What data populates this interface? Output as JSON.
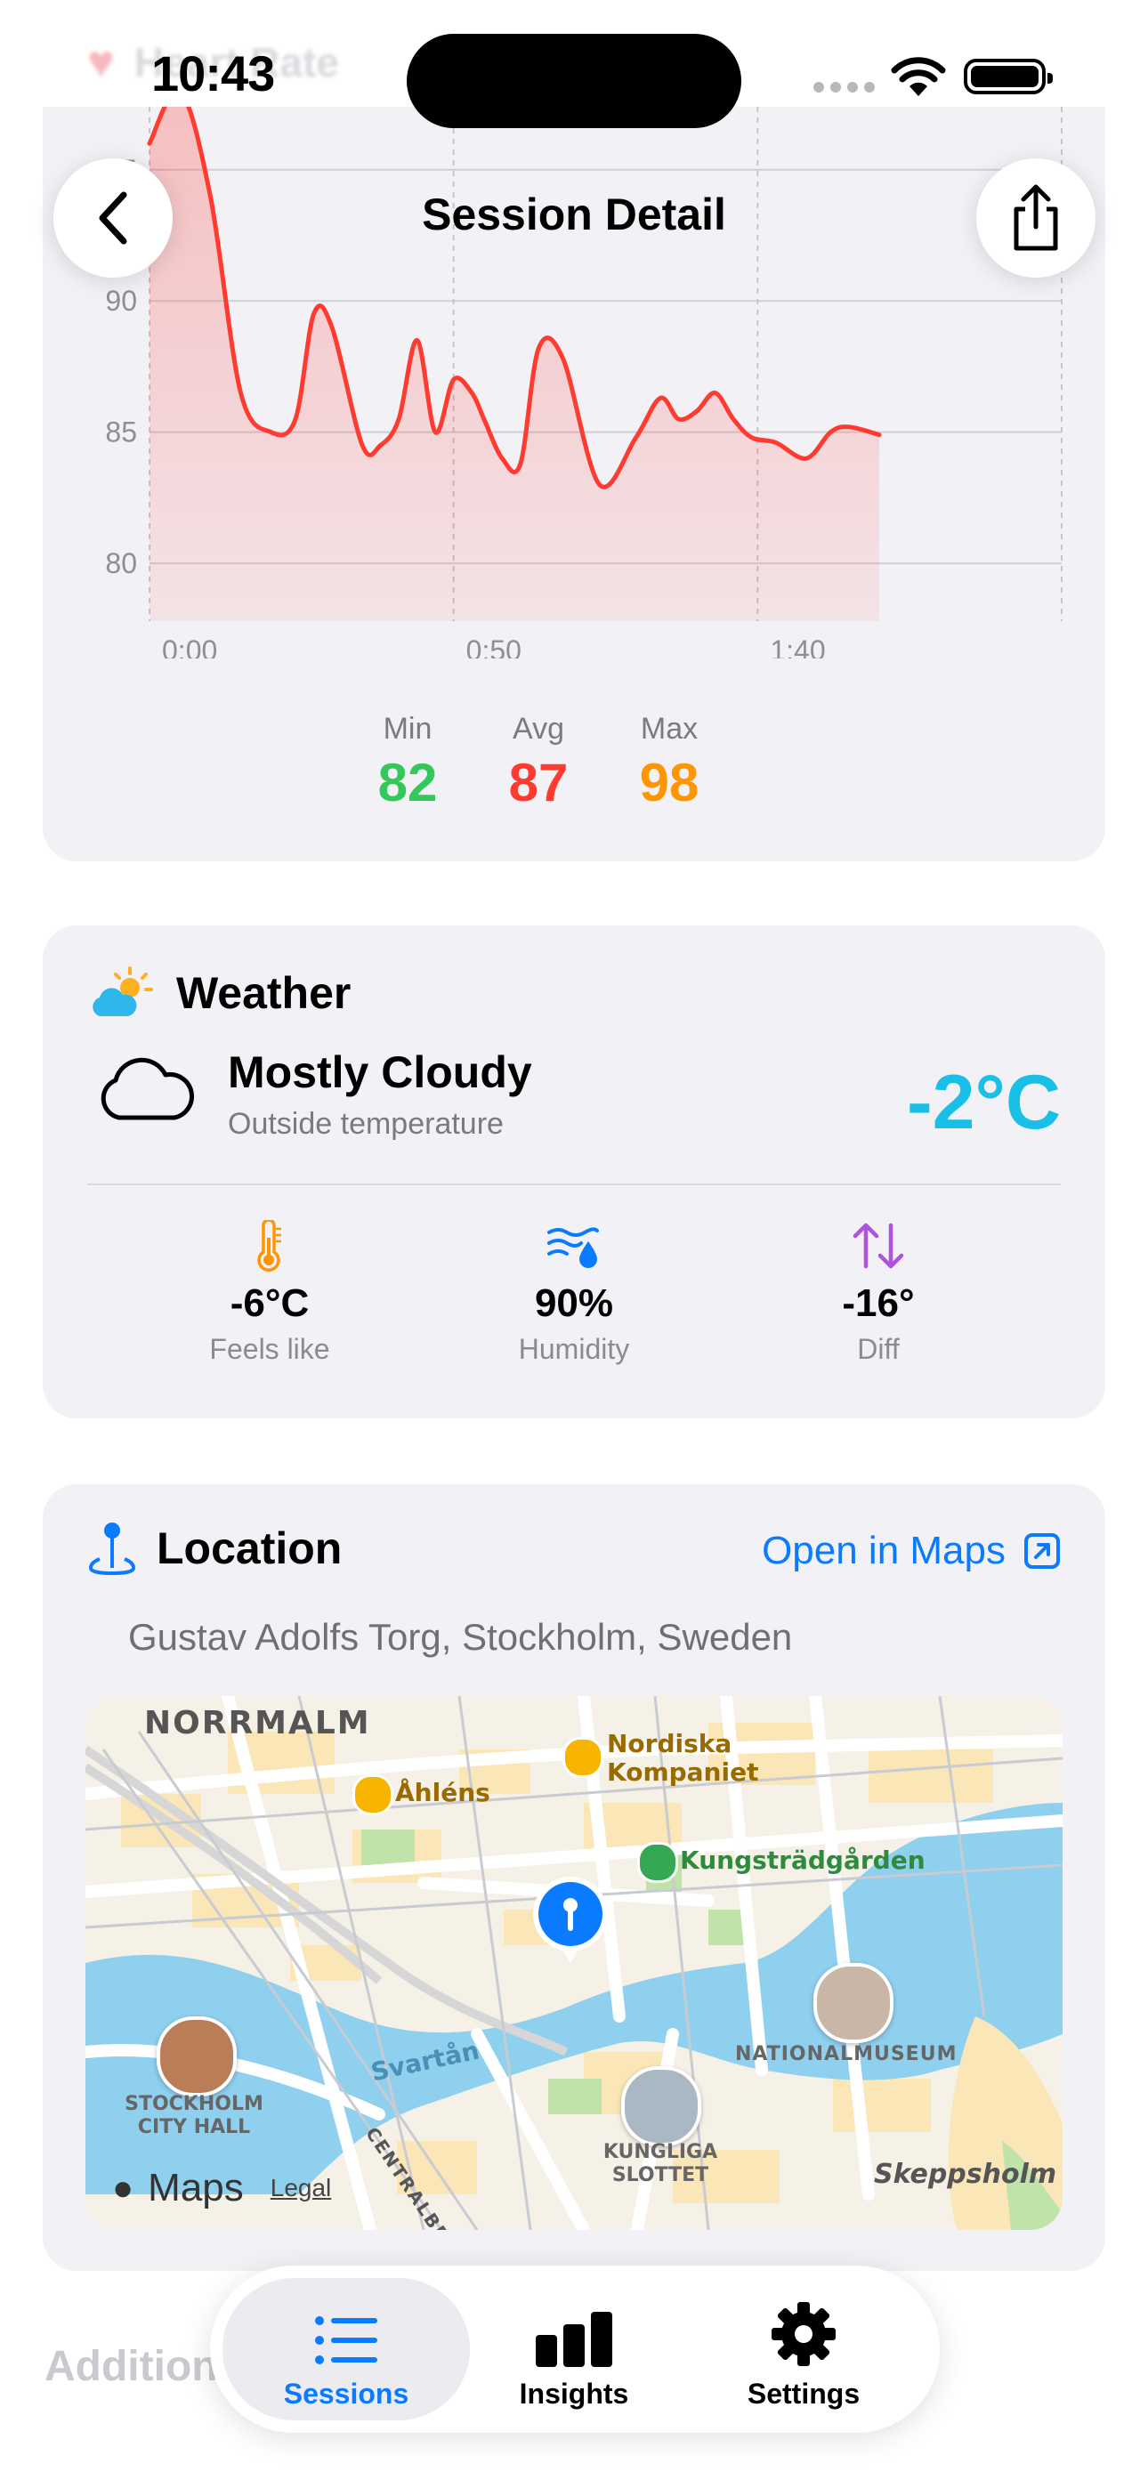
{
  "status_bar": {
    "time": "10:43"
  },
  "background_header": {
    "title": "Heart Rate"
  },
  "nav": {
    "title": "Session Detail"
  },
  "heart_rate": {
    "stats": [
      {
        "label": "Min",
        "value": "82",
        "color": "#34c759"
      },
      {
        "label": "Avg",
        "value": "87",
        "color": "#ff3b30"
      },
      {
        "label": "Max",
        "value": "98",
        "color": "#ff9500"
      }
    ]
  },
  "chart_data": {
    "type": "area",
    "xlabel": "",
    "ylabel": "",
    "x_ticks": [
      {
        "label": "0:00",
        "value": 0
      },
      {
        "label": "0:50",
        "value": 50
      },
      {
        "label": "1:40",
        "value": 100
      }
    ],
    "y_ticks": [
      80,
      85,
      90,
      95
    ],
    "xlim": [
      0,
      150
    ],
    "ylim": [
      77.8,
      97.4
    ],
    "grid": true,
    "series": [
      {
        "color": "#ff3b30",
        "x": [
          0,
          5,
          10,
          15,
          20,
          24,
          27,
          30,
          35,
          38,
          41,
          44,
          47,
          50,
          53,
          55,
          58,
          61,
          64,
          68,
          74,
          80,
          84,
          87,
          90,
          93,
          96,
          99,
          103,
          108,
          112,
          115,
          120
        ],
        "y": [
          96.0,
          98.0,
          94.0,
          86.5,
          85.0,
          85.5,
          89.5,
          89.0,
          84.5,
          84.5,
          85.5,
          88.5,
          85.0,
          87.0,
          86.5,
          85.5,
          84.0,
          83.8,
          88.2,
          87.8,
          83.0,
          84.8,
          86.3,
          85.5,
          85.8,
          86.5,
          85.5,
          84.8,
          84.6,
          84.0,
          85.0,
          85.2,
          84.9
        ]
      }
    ]
  },
  "weather": {
    "title": "Weather",
    "condition": "Mostly Cloudy",
    "subtitle": "Outside temperature",
    "temperature": "-2°C",
    "stats": [
      {
        "icon": "thermometer-icon",
        "value": "-6°C",
        "label": "Feels like",
        "color": "#ff9500"
      },
      {
        "icon": "humidity-icon",
        "value": "90%",
        "label": "Humidity",
        "color": "#0a7aff"
      },
      {
        "icon": "arrows-up-down-icon",
        "value": "-16°",
        "label": "Diff",
        "color": "#af52de"
      }
    ]
  },
  "location": {
    "title": "Location",
    "open_in_maps": "Open in Maps",
    "address": "Gustav Adolfs Torg, Stockholm, Sweden",
    "map_labels": {
      "norrmalm": "NORRMALM",
      "nordiska_1": "Nordiska",
      "nordiska_2": "Kompaniet",
      "ahlens": "Åhléns",
      "kungstradgarden": "Kungsträdgården",
      "nationalmuseum": "NATIONALMUSEUM",
      "city_hall_1": "STOCKHOLM",
      "city_hall_2": "CITY HALL",
      "svartan": "Svartån",
      "centralbron": "CENTRALBRON",
      "slottet_1": "KUNGLIGA",
      "slottet_2": "SLOTTET",
      "skeppsholmen": "Skeppsholm",
      "maps_brand": "Maps",
      "legal": "Legal"
    }
  },
  "additional": {
    "title": "Additional"
  },
  "tabs": [
    {
      "label": "Sessions",
      "active": true
    },
    {
      "label": "Insights",
      "active": false
    },
    {
      "label": "Settings",
      "active": false
    }
  ]
}
